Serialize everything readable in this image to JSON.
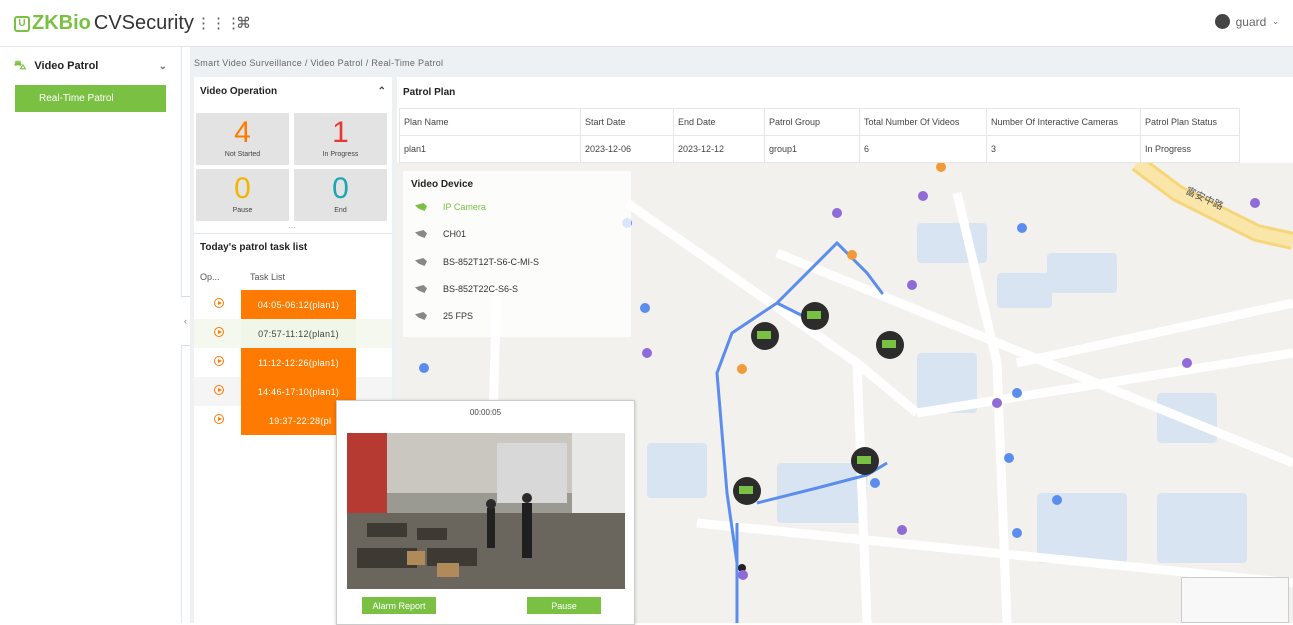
{
  "app": {
    "brand_prefix": "ZKBio",
    "brand_suffix": "CVSecurity",
    "user": "guard",
    "topbar_icons": [
      "grid-icon",
      "command-icon"
    ]
  },
  "sidebar": {
    "module": "Video Patrol",
    "items": [
      {
        "label": "Real-Time Patrol",
        "active": true
      }
    ]
  },
  "breadcrumb": "Smart Video Surveillance / Video Patrol / Real-Time Patrol",
  "video_operation": {
    "title": "Video Operation",
    "stats": [
      {
        "value": "4",
        "label": "Not Started",
        "color": "#ff7a00"
      },
      {
        "value": "1",
        "label": "In Progress",
        "color": "#e53935"
      },
      {
        "value": "0",
        "label": "Pause",
        "color": "#f5b400"
      },
      {
        "value": "0",
        "label": "End",
        "color": "#1aa7b3"
      }
    ]
  },
  "task_list": {
    "title": "Today's patrol task list",
    "col_op": "Op...",
    "col_task": "Task List",
    "tasks": [
      {
        "label": "04:05-06:12(plan1)",
        "status": "not-started"
      },
      {
        "label": "07:57-11:12(plan1)",
        "status": "in-progress"
      },
      {
        "label": "11:12-12:26(plan1)",
        "status": "not-started"
      },
      {
        "label": "14:46-17:10(plan1)",
        "status": "not-started"
      },
      {
        "label": "19:37-22:28(pl",
        "status": "not-started"
      }
    ]
  },
  "patrol_plan": {
    "title": "Patrol Plan",
    "columns": [
      "Plan Name",
      "Start Date",
      "End Date",
      "Patrol Group",
      "Total Number Of Videos",
      "Number Of Interactive Cameras",
      "Patrol Plan Status"
    ],
    "row": [
      "plan1",
      "2023-12-06",
      "2023-12-12",
      "group1",
      "6",
      "3",
      "In Progress"
    ]
  },
  "video_device": {
    "title": "Video Device",
    "items": [
      "IP Camera",
      "CH01",
      "BS-852T12T-S6-C-MI-S",
      "BS-852T22C-S6-S",
      "25 FPS"
    ]
  },
  "video_popup": {
    "time": "00:00:05",
    "alarm_label": "Alarm Report",
    "pause_label": "Pause"
  },
  "map_labels": [
    "富安中路"
  ],
  "colors": {
    "accent": "#7ac143",
    "orange": "#ff7a00",
    "route": "#5b8def"
  }
}
